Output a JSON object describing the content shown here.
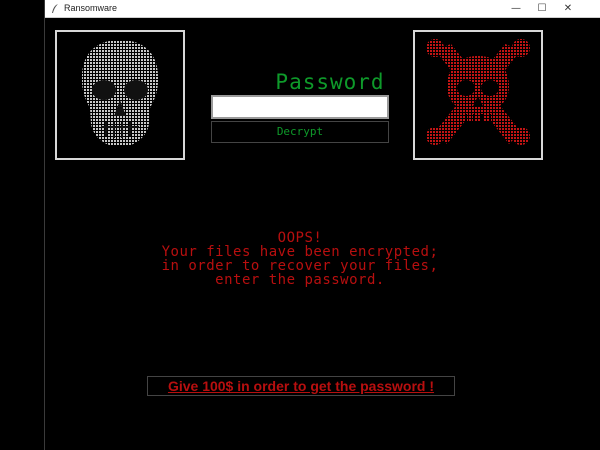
{
  "window": {
    "title": "Ransomware",
    "icon": "feather-icon",
    "controls": {
      "minimize": "—",
      "maximize": "☐",
      "close": "✕"
    }
  },
  "password": {
    "label": "Password",
    "value": "",
    "placeholder": ""
  },
  "decrypt_button": "Decrypt",
  "message": {
    "line1": "OOPS!",
    "line2": "Your files have been encrypted;",
    "line3": "in order to recover your files,",
    "line4": "enter the password."
  },
  "ransom_button": "Give 100$ in order to get the password !",
  "images": {
    "left": "ascii-skull-image",
    "right": "skull-and-crossbones-image"
  },
  "colors": {
    "background": "#000000",
    "accent_green": "#0e9a2a",
    "accent_red": "#b80f0f"
  }
}
